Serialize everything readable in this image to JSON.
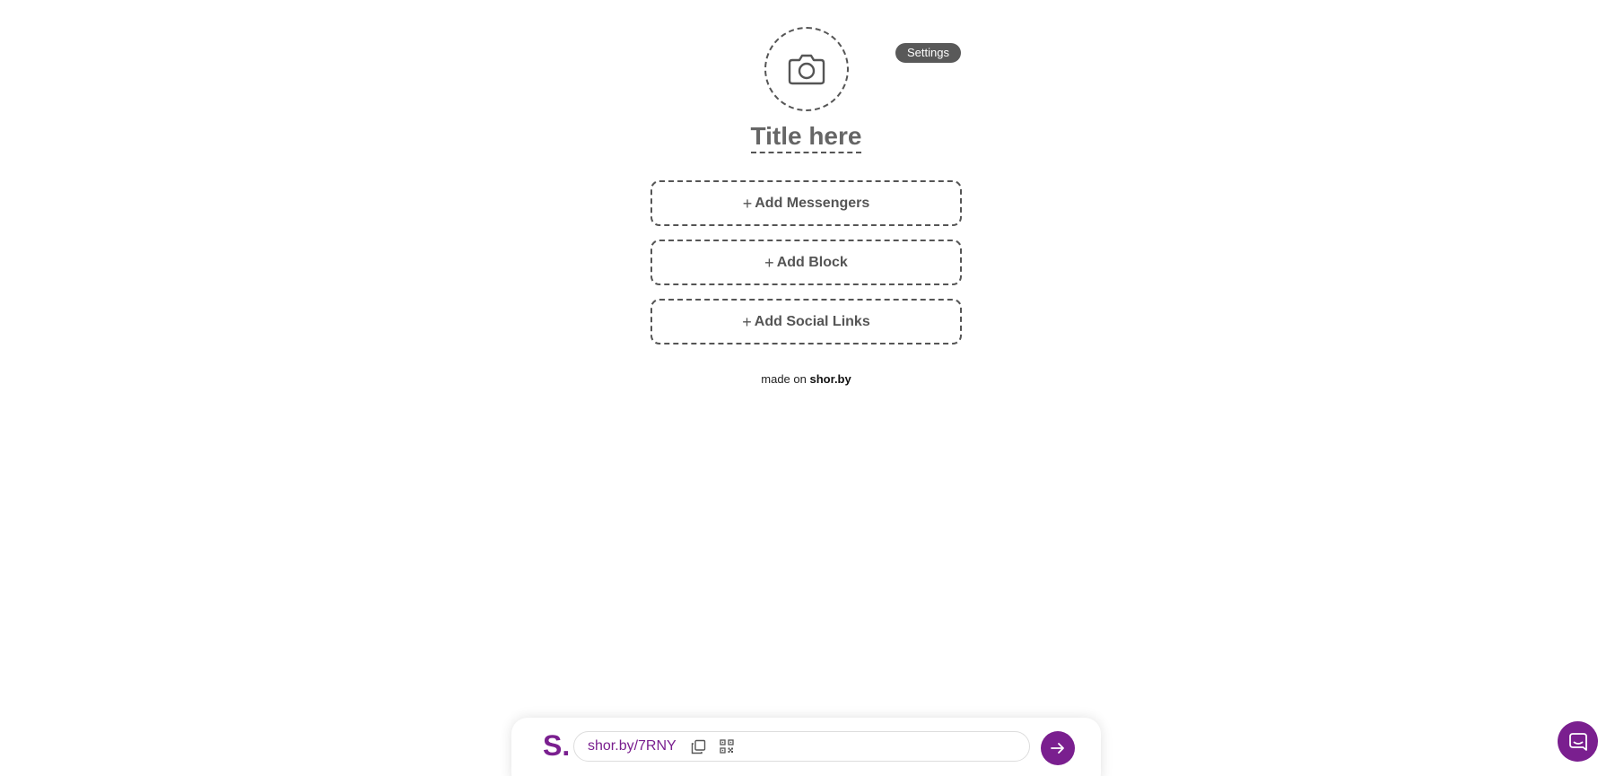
{
  "editor": {
    "settings_label": "Settings",
    "title_placeholder": "Title here",
    "add_messengers_label": "Add Messengers",
    "add_block_label": "Add Block",
    "add_social_links_label": "Add Social Links",
    "plus_symbol": "+",
    "footer_prefix": "made on",
    "footer_brand": "shor.by"
  },
  "bottom_bar": {
    "logo": "S.",
    "short_url": "shor.by/7RNY",
    "copy_icon": "copy-icon",
    "qr_icon": "qr-code-icon",
    "go_icon": "arrow-right-icon"
  },
  "chat": {
    "icon": "chat-icon"
  },
  "colors": {
    "accent": "#7a1f8f",
    "text_gray": "#555555",
    "settings_bg": "#595959"
  }
}
